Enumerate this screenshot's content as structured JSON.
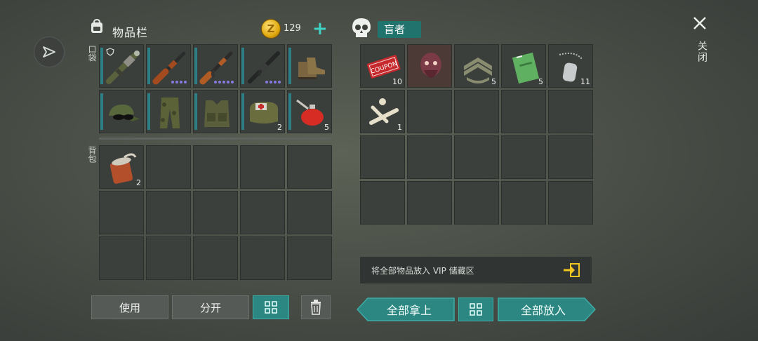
{
  "inventory": {
    "title": "物品栏",
    "coin_count": "129",
    "pocket_label": "口袋",
    "backpack_label": "背包",
    "pocket_items": [
      {
        "name": "rocket-launcher-icon",
        "count": "",
        "dots": 0
      },
      {
        "name": "shotgun-icon",
        "count": "",
        "dots": 4
      },
      {
        "name": "assault-rifle-icon",
        "count": "",
        "dots": 5
      },
      {
        "name": "m16-rifle-icon",
        "count": "",
        "dots": 4
      },
      {
        "name": "boots-icon",
        "count": "",
        "dots": 0
      },
      {
        "name": "cap-sunglasses-icon",
        "count": "",
        "dots": 0
      },
      {
        "name": "camo-pants-icon",
        "count": "",
        "dots": 0
      },
      {
        "name": "tactical-vest-icon",
        "count": "",
        "dots": 0
      },
      {
        "name": "medkit-bag-icon",
        "count": "2",
        "dots": 0
      },
      {
        "name": "fuel-can-icon",
        "count": "5",
        "dots": 0
      }
    ],
    "backpack_items": [
      {
        "name": "canned-food-icon",
        "count": "2"
      }
    ],
    "buttons": {
      "use": "使用",
      "split": "分开"
    }
  },
  "loot": {
    "name": "盲者",
    "items": [
      {
        "name": "combat-coupon-icon",
        "count": "10"
      },
      {
        "name": "mutant-head-icon",
        "count": ""
      },
      {
        "name": "sergeant-stripes-icon",
        "count": "5"
      },
      {
        "name": "notebook-icon",
        "count": "5"
      },
      {
        "name": "dog-tag-icon",
        "count": "11"
      },
      {
        "name": "bones-icon",
        "count": "1"
      }
    ],
    "coupon_text": "COUPON",
    "vip_text": "将全部物品放入 VIP 储藏区",
    "take_all": "全部拿上",
    "put_all": "全部放入"
  },
  "close_label": "关闭"
}
